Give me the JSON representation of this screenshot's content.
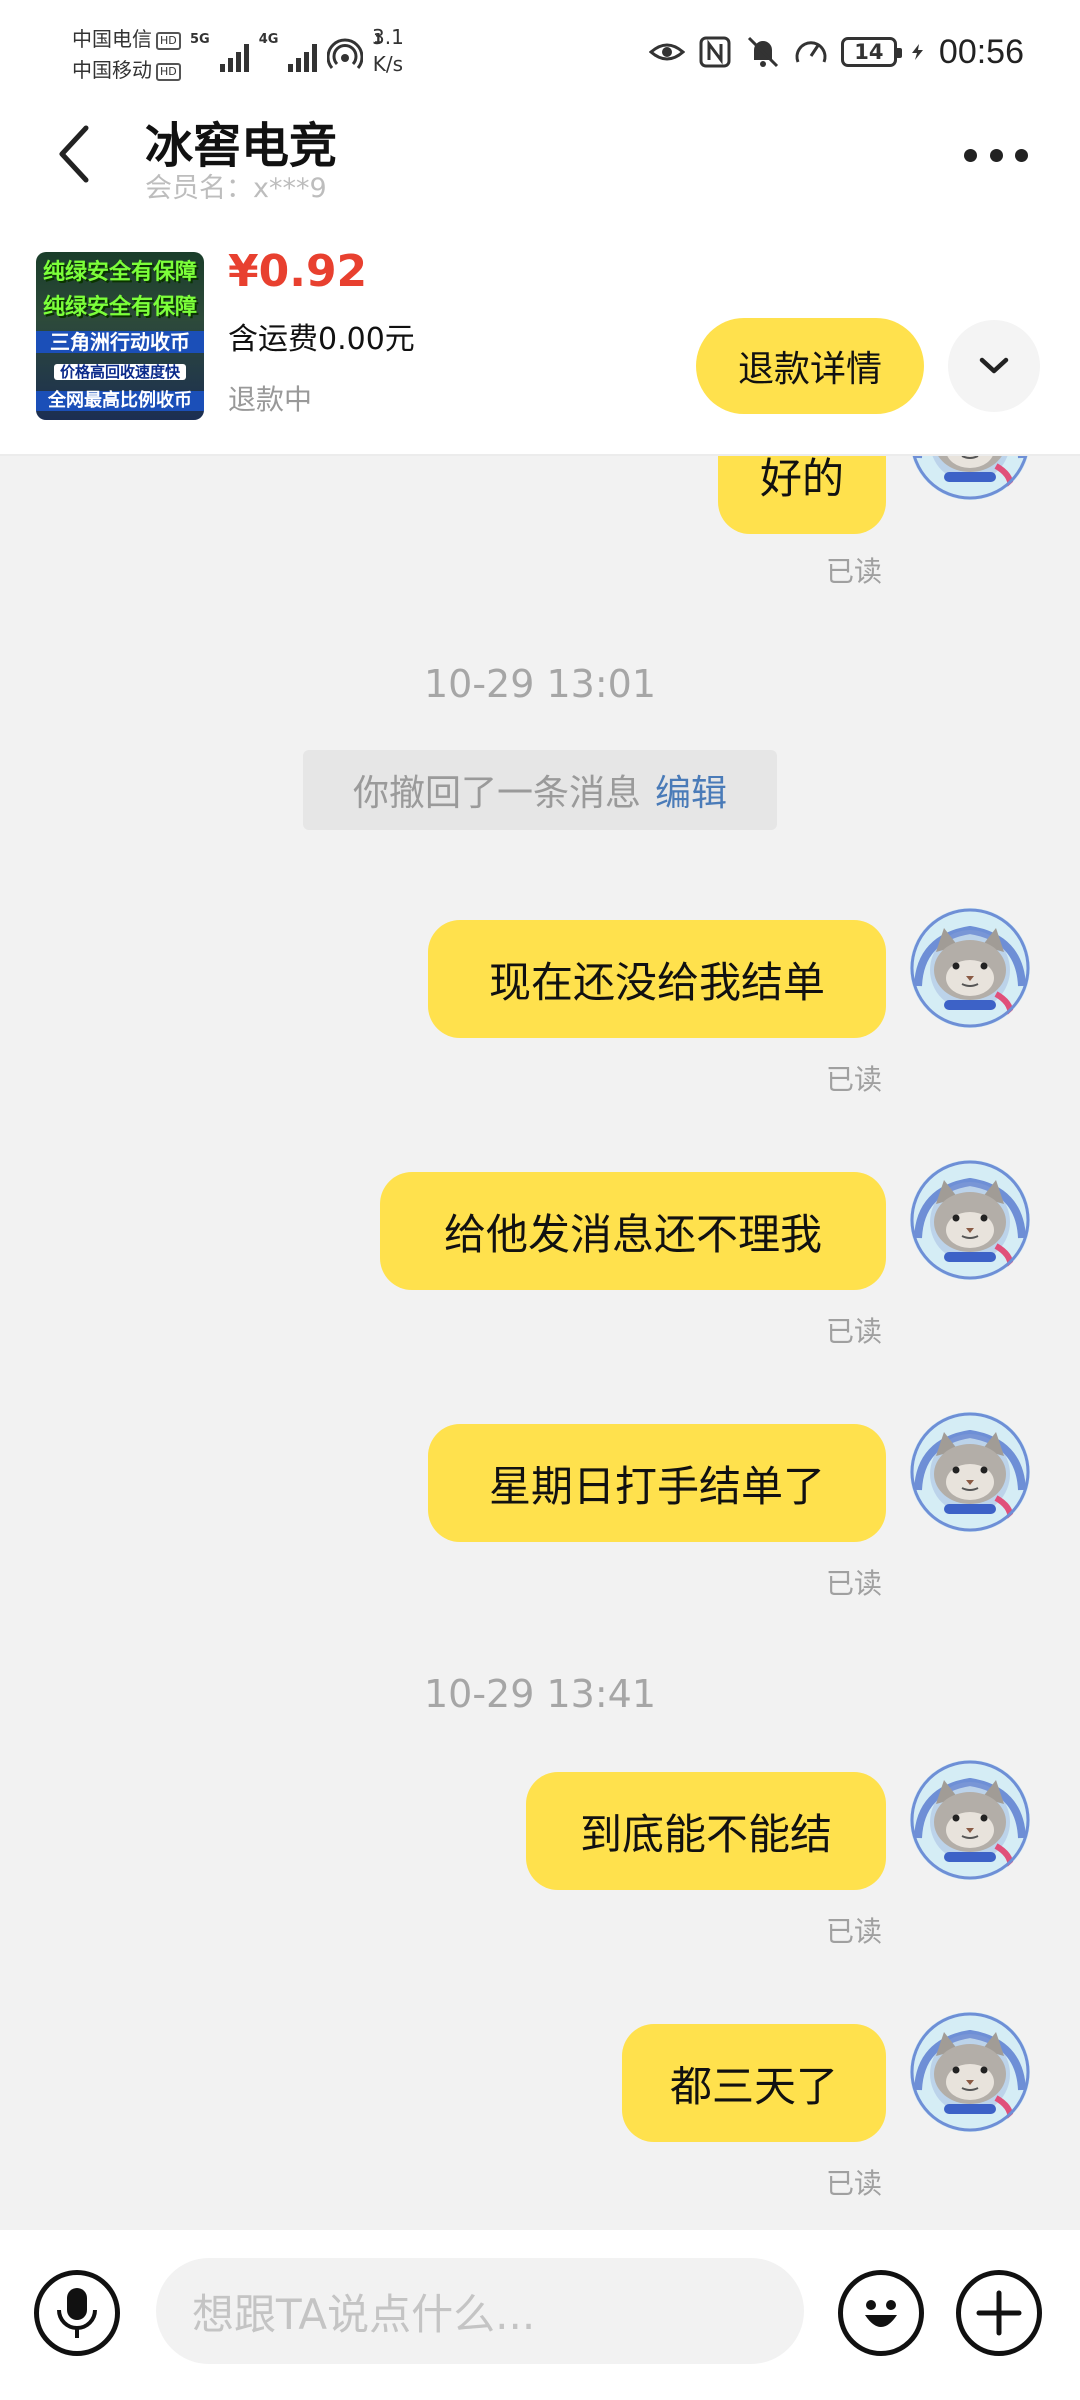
{
  "status_bar": {
    "carrier_1": "中国电信",
    "carrier_2": "中国移动",
    "hd": "HD",
    "sig_5g": "5G",
    "sig_4g": "4G",
    "hotspot_count": "1",
    "speed_value": "3.1",
    "speed_unit": "K/s",
    "battery": "14",
    "time": "00:56"
  },
  "header": {
    "shop_name": "冰窖电竞",
    "member_label": "会员名：x***9"
  },
  "product": {
    "thumb_lines": [
      "纯绿安全有保障",
      "纯绿安全有保障",
      "三角洲行动收币",
      "价格高回收速度快",
      "全网最高比例收币"
    ],
    "price": "¥0.92",
    "shipping": "含运费0.00元",
    "status": "退款中",
    "refund_button": "退款详情"
  },
  "chat": {
    "partial_message": "好的",
    "read_label": "已读",
    "timestamp_1": "10-29 13:01",
    "recall_text": "你撤回了一条消息",
    "recall_edit": "编辑",
    "messages_1": [
      "现在还没给我结单",
      "给他发消息还不理我",
      "星期日打手结单了"
    ],
    "timestamp_2": "10-29 13:41",
    "messages_2": [
      "到底能不能结",
      "都三天了"
    ]
  },
  "input_bar": {
    "placeholder": "想跟TA说点什么..."
  },
  "colors": {
    "accent_yellow": "#ffe14d",
    "price_red": "#e8402f",
    "link_blue": "#4a7bb8"
  }
}
